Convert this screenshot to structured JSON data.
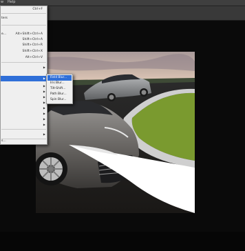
{
  "menubar": {
    "items": [
      "w",
      "Help"
    ]
  },
  "filter_menu": {
    "rows": [
      {
        "label": "",
        "shortcut": "Ctrl+F"
      },
      {
        "label": "ters",
        "shortcut": ""
      },
      {
        "label": "e...",
        "shortcut": "Alt+Shift+Ctrl+A"
      },
      {
        "label": "",
        "shortcut": "Shift+Ctrl+A"
      },
      {
        "label": "",
        "shortcut": "Shift+Ctrl+R"
      },
      {
        "label": "",
        "shortcut": "Shift+Ctrl+X"
      },
      {
        "label": "",
        "shortcut": "Alt+Ctrl+V"
      },
      {
        "label": "s...",
        "shortcut": ""
      }
    ]
  },
  "blur_submenu": {
    "items": [
      "Field Blur...",
      "Iris Blur...",
      "Tilt-Shift...",
      "Path Blur...",
      "Spin Blur..."
    ]
  },
  "colors": {
    "menubar": "#3f3f3f",
    "options_bar": "#393939",
    "menu_bg": "#efefef",
    "highlight": "#2f6fd8",
    "grass": "#7a9a2f",
    "car_front": "#6e6b68",
    "car_back": "#8a8c8f"
  }
}
